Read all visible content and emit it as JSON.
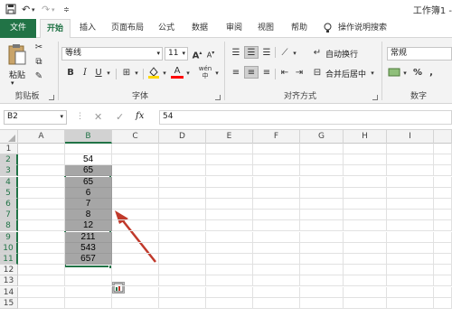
{
  "window": {
    "title": "工作簿1 -"
  },
  "tabs": [
    "文件",
    "开始",
    "插入",
    "页面布局",
    "公式",
    "数据",
    "审阅",
    "视图",
    "帮助",
    "操作说明搜索"
  ],
  "ribbon": {
    "clipboard": {
      "paste_label": "粘贴",
      "group_label": "剪贴板"
    },
    "font": {
      "name": "等线",
      "size": "11",
      "bold": "B",
      "italic": "I",
      "underline": "U",
      "group_label": "字体",
      "grow": "A",
      "shrink": "A",
      "wen": "wén"
    },
    "alignment": {
      "wrap_label": "自动换行",
      "merge_label": "合并后居中",
      "group_label": "对齐方式"
    },
    "number": {
      "format": "常规",
      "percent": "%",
      "comma": ",",
      "group_label": "数字"
    }
  },
  "formula_bar": {
    "name_box": "B2",
    "fx": "fx",
    "content": "54"
  },
  "columns": [
    "A",
    "B",
    "C",
    "D",
    "E",
    "F",
    "G",
    "H",
    "I"
  ],
  "rows": [
    "1",
    "2",
    "3",
    "4",
    "5",
    "6",
    "7",
    "8",
    "9",
    "10",
    "11",
    "12",
    "13",
    "14",
    "15"
  ],
  "column_b_values": [
    "54",
    "65",
    "65",
    "6",
    "7",
    "8",
    "12",
    "211",
    "543",
    "657"
  ],
  "colors": {
    "accent": "#217346",
    "selection": "#a6a6a6",
    "arrow": "#c0392b"
  }
}
